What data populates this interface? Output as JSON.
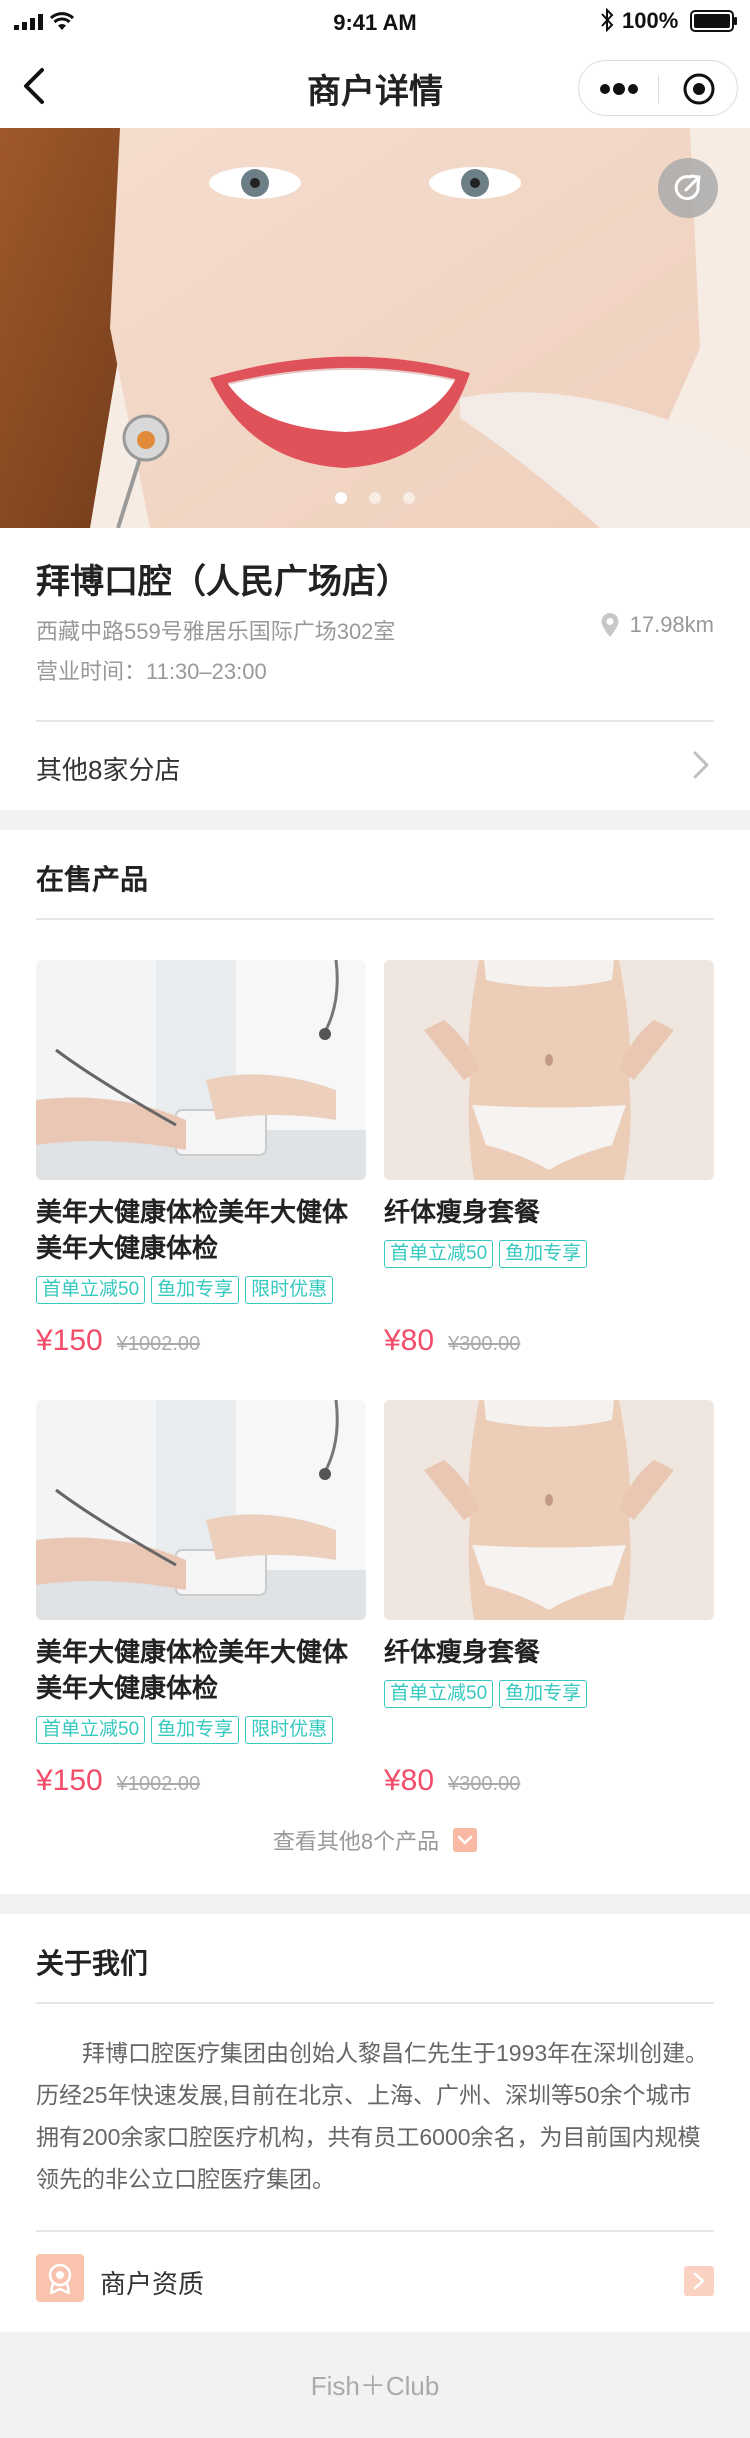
{
  "status_bar": {
    "time": "9:41 AM",
    "battery": "100%"
  },
  "nav": {
    "title": "商户详情"
  },
  "hero": {
    "slide_count": 3,
    "active_slide": 1
  },
  "store": {
    "name": "拜博口腔（人民广场店）",
    "address": "西藏中路559号雅居乐国际广场302室",
    "distance": "17.98km",
    "hours": "营业时间：11:30–23:00",
    "branches_label": "其他8家分店"
  },
  "products_section": {
    "title": "在售产品",
    "items": [
      {
        "title": "美年大健康体检美年大健体美年大健康体检",
        "tags": [
          "首单立减50",
          "鱼加专享",
          "限时优惠"
        ],
        "price": "¥150",
        "original_price": "¥1002.00"
      },
      {
        "title": "纤体瘦身套餐",
        "tags": [
          "首单立减50",
          "鱼加专享"
        ],
        "price": "¥80",
        "original_price": "¥300.00"
      },
      {
        "title": "美年大健康体检美年大健体美年大健康体检",
        "tags": [
          "首单立减50",
          "鱼加专享",
          "限时优惠"
        ],
        "price": "¥150",
        "original_price": "¥1002.00"
      },
      {
        "title": "纤体瘦身套餐",
        "tags": [
          "首单立减50",
          "鱼加专享"
        ],
        "price": "¥80",
        "original_price": "¥300.00"
      }
    ],
    "more_label": "查看其他8个产品"
  },
  "about": {
    "title": "关于我们",
    "text": "拜博口腔医疗集团由创始人黎昌仁先生于1993年在深圳创建。历经25年快速发展,目前在北京、上海、广州、深圳等50余个城市拥有200余家口腔医疗机构，共有员工6000余名，为目前国内规模领先的非公立口腔医疗集团。",
    "qualification_label": "商户资质"
  },
  "footer": {
    "brand": "Fish＋Club"
  },
  "colors": {
    "accent_price": "#f34b6a",
    "tag": "#35c9bf",
    "icon_peach": "#f9c3ae"
  }
}
